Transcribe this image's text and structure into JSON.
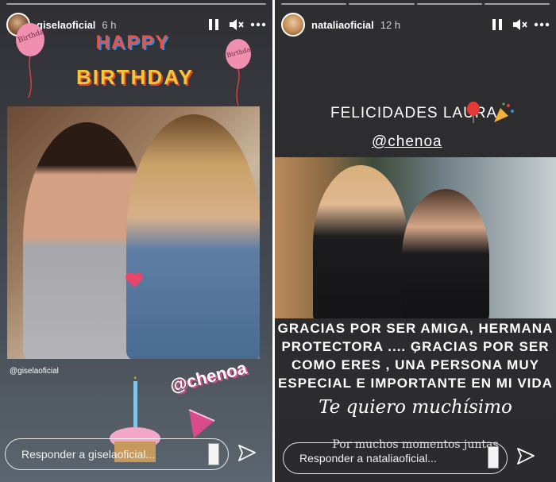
{
  "left_story": {
    "username": "giselaoficial",
    "time_ago": "6 h",
    "greeting_line1": "HAPPY",
    "greeting_line2": "BIRTHDAY",
    "balloon_text": "Birthday",
    "photo_credit": "@giselaoficial",
    "mention": "@chenoa",
    "reply_placeholder": "Responder a giselaoficial..."
  },
  "right_story": {
    "username": "nataliaoficial",
    "time_ago": "12 h",
    "title": "FELICIDADES LAURA",
    "mention": "@chenoa",
    "caption_line1": "GRACIAS POR SER AMIGA, HERMANA ,",
    "caption_line2": "PROTECTORA .... GRACIAS POR SER",
    "caption_line3": "COMO ERES , UNA PERSONA MUY",
    "caption_line4": "ESPECIAL E IMPORTANTE EN MI VIDA",
    "script_line1": "Te quiero muchísimo",
    "script_line2": "Por muchos momentos juntas",
    "reply_placeholder": "Responder a nataliaoficial..."
  },
  "icons": {
    "pause": "pause-icon",
    "mute": "mute-icon",
    "more": "more-icon",
    "send": "send-icon"
  },
  "colors": {
    "mention_pink": "#d94b8a",
    "balloon_pink": "#f08fb0",
    "cupcake_frosting": "#f3a7c6"
  }
}
